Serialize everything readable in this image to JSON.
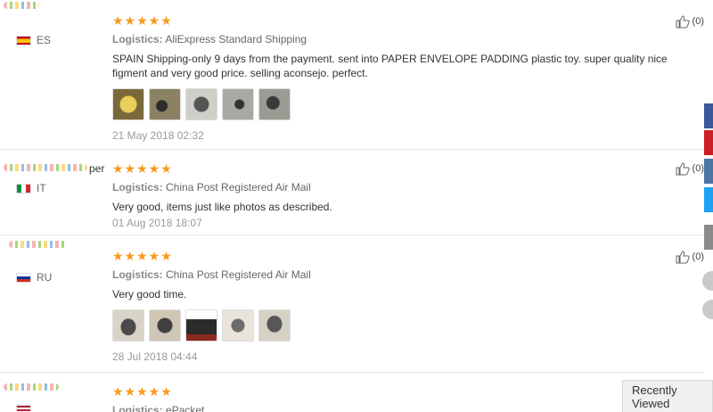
{
  "reviews": [
    {
      "username": "",
      "country_code": "ES",
      "stars": "★★★★★",
      "logistics_label": "Logistics:",
      "logistics_value": "AliExpress Standard Shipping",
      "feedback": "SPAIN Shipping-only 9 days from the payment. sent into PAPER ENVELOPE PADDING plastic toy. super quality nice figment and very good price. selling aconsejo. perfect.",
      "date": "21 May 2018 02:32",
      "helpful_count": "(0)",
      "photo_count": 5
    },
    {
      "username": "per",
      "country_code": "IT",
      "stars": "★★★★★",
      "logistics_label": "Logistics:",
      "logistics_value": "China Post Registered Air Mail",
      "feedback": "Very good, items just like photos as described.",
      "date": "01 Aug 2018 18:07",
      "helpful_count": "(0)",
      "photo_count": 0
    },
    {
      "username": "",
      "country_code": "RU",
      "stars": "★★★★★",
      "logistics_label": "Logistics:",
      "logistics_value": "China Post Registered Air Mail",
      "feedback": "Very good time.",
      "date": "28 Jul 2018 04:44",
      "helpful_count": "(0)",
      "photo_count": 5
    },
    {
      "username": "",
      "country_code": "",
      "stars": "★★★★★",
      "logistics_label": "Logistics:",
      "logistics_value": "ePacket"
    }
  ],
  "recently_viewed": "Recently Viewed",
  "colors": {
    "star": "#f79a1c",
    "facebook": "#3b5998",
    "pinterest": "#cb2027",
    "vk": "#4c75a3",
    "twitter": "#1da1f2"
  }
}
